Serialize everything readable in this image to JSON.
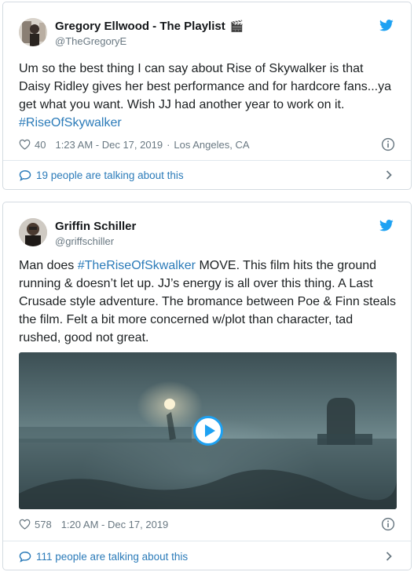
{
  "tweets": [
    {
      "display_name": "Gregory Ellwood - The Playlist",
      "name_emoji": "🎬",
      "handle": "@TheGregoryE",
      "text_before": "Um so the best thing I can say about Rise of Skywalker is that Daisy Ridley gives her best performance and for hardcore fans...ya get what you want. Wish JJ had another year to work on it. ",
      "hashtag": "#RiseOfSkywalker",
      "text_after": "",
      "likes": "40",
      "time": "1:23 AM - Dec 17, 2019",
      "location_sep": "·",
      "location": "Los Angeles, CA",
      "footer": "19 people are talking about this"
    },
    {
      "display_name": "Griffin Schiller",
      "handle": "@griffschiller",
      "text_before": "Man does ",
      "hashtag": "#TheRiseOfSkwalker",
      "text_after": " MOVE. This film hits the ground running & doesn’t let up. JJ’s energy is all over this thing. A Last Crusade style adventure. The bromance between Poe & Finn steals the film. Felt a bit more concerned w/plot than character, tad rushed, good not great.",
      "likes": "578",
      "time": "1:20 AM - Dec 17, 2019",
      "footer": "111 people are talking about this"
    }
  ],
  "colors": {
    "link": "#2b7bb9",
    "twitter_blue": "#1da1f2",
    "muted": "#697882",
    "border": "#d4dbe1"
  },
  "icons": {
    "brand": "twitter-bird-icon",
    "like": "heart-icon",
    "info": "info-icon",
    "replies": "speech-bubble-icon",
    "more": "chevron-right-icon",
    "play": "play-icon"
  }
}
